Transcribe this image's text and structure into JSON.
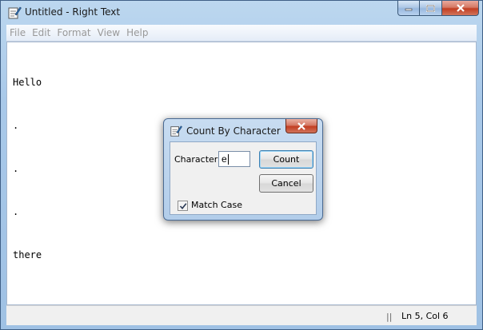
{
  "window": {
    "title": "Untitled - Right Text",
    "icon": "notepad-pencil-icon"
  },
  "menu": [
    "File",
    "Edit",
    "Format",
    "View",
    "Help"
  ],
  "editor": {
    "lines": [
      "Hello",
      ".",
      ".",
      ".",
      "there"
    ]
  },
  "status": {
    "separator": "||",
    "position": "Ln 5, Col 6"
  },
  "dialog": {
    "title": "Count By Character",
    "icon": "notepad-pencil-icon",
    "character_label": "Character:",
    "character_value": "e",
    "count_label": "Count",
    "cancel_label": "Cancel",
    "match_case_label": "Match Case",
    "match_case_checked": true
  }
}
